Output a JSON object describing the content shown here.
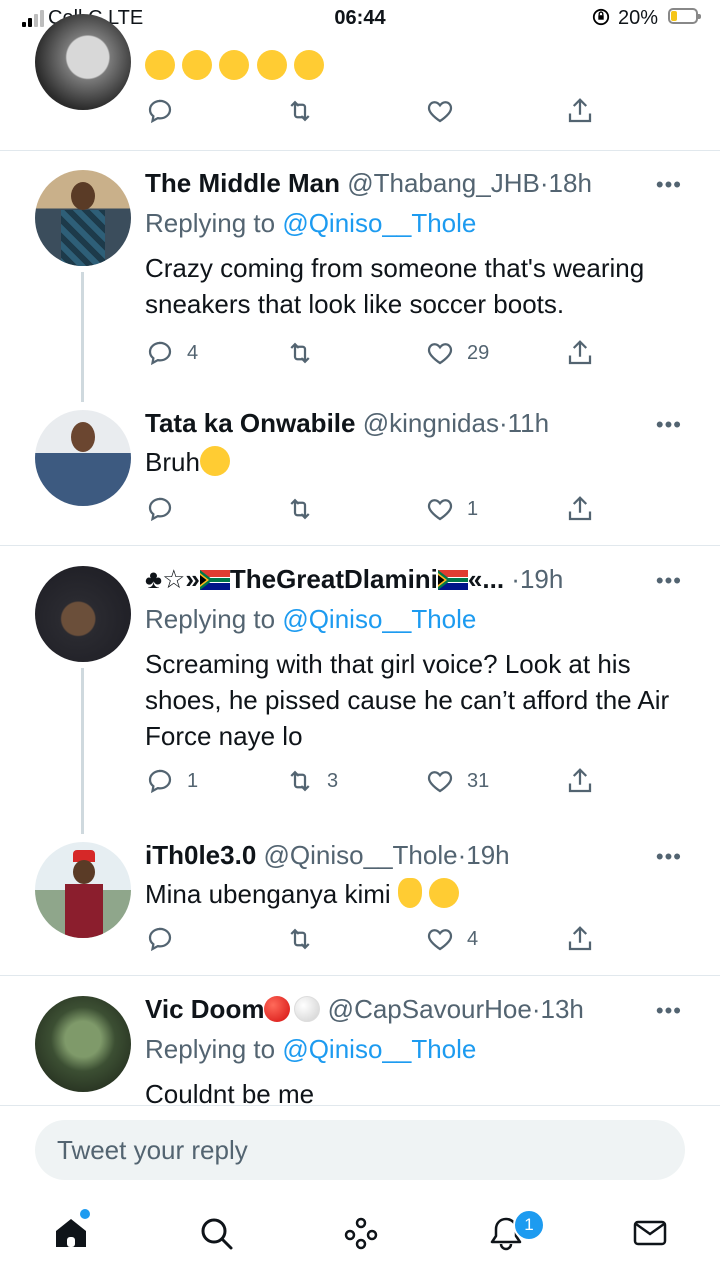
{
  "status_bar": {
    "carrier": "Cell C  LTE",
    "time": "06:44",
    "battery": "20%",
    "battery_level": 0.2
  },
  "tweets": [
    {
      "name": "",
      "handle": "",
      "time": "",
      "text": "",
      "emojis": "😂😂😂😂😂",
      "replies": "",
      "retweets": "",
      "likes": ""
    },
    {
      "name": "The Middle Man",
      "handle": "@Thabang_JHB",
      "dot": "·",
      "time": "18h",
      "replying_prefix": "Replying to",
      "replying_to": "@Qiniso__Thole",
      "text": "Crazy coming from someone that's wearing sneakers that look like soccer boots.",
      "replies": "4",
      "retweets": "",
      "likes": "29"
    },
    {
      "name": "Tata ka Onwabile",
      "handle": "@kingnidas",
      "dot": "·",
      "time": "11h",
      "text": "Bruh",
      "replies": "",
      "retweets": "",
      "likes": "1"
    },
    {
      "name_prefix": "♣☆»",
      "name": "TheGreatDlamini",
      "name_suffix": "«...",
      "dot": "·",
      "time": "19h",
      "replying_prefix": "Replying to",
      "replying_to": "@Qiniso__Thole",
      "text": "Screaming with that girl voice? Look at his shoes, he pissed cause he can’t afford the Air Force naye lo",
      "replies": "1",
      "retweets": "3",
      "likes": "31"
    },
    {
      "name": "iTh0le3.0",
      "handle": "@Qiniso__Thole",
      "dot": "·",
      "time": "19h",
      "text": "Mina ubenganya kimi",
      "replies": "",
      "retweets": "",
      "likes": "4"
    },
    {
      "name": "Vic Doom",
      "handle": "@CapSavourHoe",
      "dot": "·",
      "time": "13h",
      "replying_prefix": "Replying to",
      "replying_to": "@Qiniso__Thole",
      "text": "Couldnt be me"
    }
  ],
  "more_label": "•••",
  "reply_box": {
    "placeholder": "Tweet your reply"
  },
  "nav": {
    "notifications_badge": "1",
    "accent": "#1d9bf0"
  },
  "icons": [
    "reply-icon",
    "retweet-icon",
    "like-icon",
    "share-icon",
    "home-icon",
    "search-icon",
    "spaces-icon",
    "notifications-icon",
    "messages-icon"
  ]
}
